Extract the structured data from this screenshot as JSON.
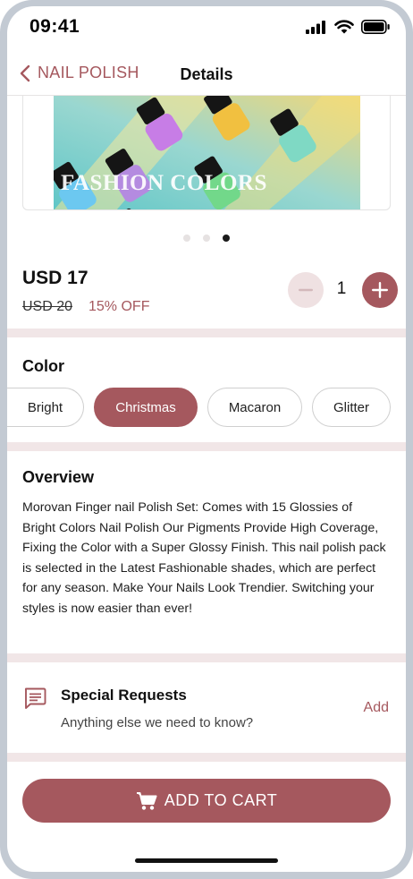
{
  "status_bar": {
    "time": "09:41",
    "icons": [
      "signal-icon",
      "wifi-icon",
      "battery-icon"
    ]
  },
  "nav": {
    "back_label": "NAIL POLISH",
    "title": "Details"
  },
  "product_image": {
    "caption": "FASHION COLORS",
    "pager_total": 3,
    "pager_active": 3
  },
  "pricing": {
    "price": "USD 17",
    "old_price": "USD 20",
    "discount": "15% OFF"
  },
  "quantity": {
    "value": "1"
  },
  "color": {
    "title": "Color",
    "options": [
      {
        "label": "Bright",
        "selected": false
      },
      {
        "label": "Christmas",
        "selected": true
      },
      {
        "label": "Macaron",
        "selected": false
      },
      {
        "label": "Glitter",
        "selected": false
      }
    ]
  },
  "overview": {
    "title": "Overview",
    "text": "Morovan Finger nail Polish Set: Comes with 15 Glossies of Bright Colors Nail Polish Our Pigments Provide High Coverage, Fixing the Color with a Super Glossy Finish. This nail polish pack is selected in the Latest Fashionable shades, which are perfect for any season. Make Your Nails Look Trendier. Switching your styles is now easier than ever!"
  },
  "special_requests": {
    "title": "Special Requests",
    "subtitle": "Anything else we need to know?",
    "action": "Add"
  },
  "cart": {
    "label": "ADD TO CART"
  },
  "colors": {
    "accent": "#a5585e",
    "accent_light": "#efe1e2",
    "separator": "#f1e6e7"
  }
}
